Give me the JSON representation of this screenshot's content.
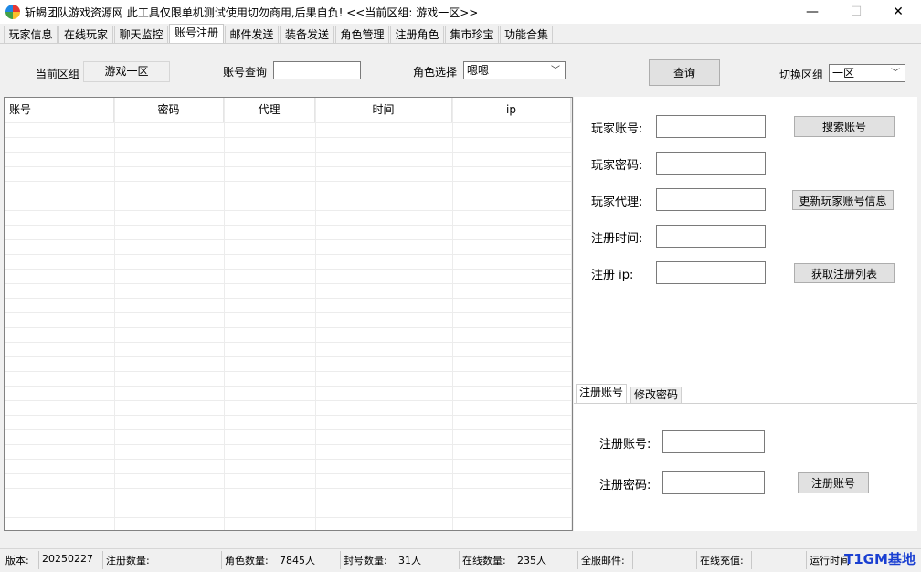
{
  "window": {
    "title": "斩蝎团队游戏资源网 此工具仅限单机测试使用切勿商用,后果自负! <<当前区组: 游戏一区>>",
    "min": "—",
    "max": "☐",
    "close": "✕"
  },
  "tabs": [
    "玩家信息",
    "在线玩家",
    "聊天监控",
    "账号注册",
    "邮件发送",
    "装备发送",
    "角色管理",
    "注册角色",
    "集市珍宝",
    "功能合集"
  ],
  "toolbar": {
    "current_group_label": "当前区组",
    "current_group_value": "游戏一区",
    "account_query_label": "账号查询",
    "account_query_value": "",
    "role_select_label": "角色选择",
    "role_select_value": "嗯嗯",
    "query_button": "查询",
    "switch_group_label": "切换区组",
    "switch_group_value": "一区"
  },
  "grid": {
    "columns": [
      "账号",
      "密码",
      "代理",
      "时间",
      "ip"
    ]
  },
  "player_form": {
    "account_label": "玩家账号:",
    "password_label": "玩家密码:",
    "agent_label": "玩家代理:",
    "reg_time_label": "注册时间:",
    "reg_ip_label": "注册 ip:",
    "search_button": "搜索账号",
    "update_button": "更新玩家账号信息",
    "list_button": "获取注册列表"
  },
  "subtabs": [
    "注册账号",
    "修改密码"
  ],
  "register_form": {
    "account_label": "注册账号:",
    "password_label": "注册密码:",
    "register_button": "注册账号"
  },
  "status": {
    "version_label": "版本:",
    "version_value": "20250227",
    "reg_count_label": "注册数量:",
    "reg_count_value": "",
    "role_count_label": "角色数量:",
    "role_count_value": "7845人",
    "ban_count_label": "封号数量:",
    "ban_count_value": "31人",
    "online_count_label": "在线数量:",
    "online_count_value": "235人",
    "all_mail_label": "全服邮件:",
    "online_recharge_label": "在线充值:",
    "runtime_label": "运行时间",
    "watermark": "T1GM基地"
  }
}
